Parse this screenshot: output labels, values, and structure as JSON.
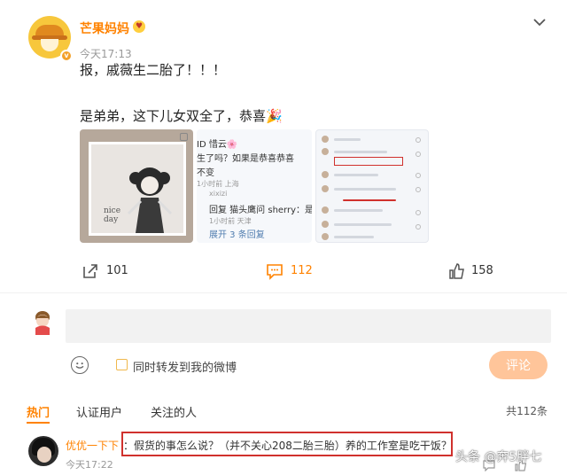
{
  "post": {
    "username": "芒果妈妈",
    "timestamp": "今天17:13",
    "text_line1": "报，戚薇生二胎了！！！",
    "text_line2": "是弟弟，这下儿女双全了，恭喜🎉"
  },
  "media": {
    "image1_note_line1": "nice",
    "image1_note_line2": "day",
    "image2_lines": [
      "ID 惜云🌸",
      "生了吗？如果是恭喜恭喜",
      "不变",
      "1小时前 上海",
      "xixizi",
      "回复 猫头鹰问 sherry：是弟",
      "1小时前 天津",
      "展开 3 条回复"
    ]
  },
  "stats": {
    "repost_count": "101",
    "comment_count": "112",
    "like_count": "158"
  },
  "composer": {
    "forward_label": "同时转发到我的微博",
    "comment_button": "评论"
  },
  "tabs": {
    "items": [
      "热门",
      "认证用户",
      "关注的人"
    ],
    "total": "共112条"
  },
  "comment": {
    "user": "优优一下下",
    "text": "：假货的事怎么说？（并不关心208二胎三胎）养的工作室是吃干饭？",
    "time": "今天17:22"
  },
  "watermark": "头条 @奔5胖七",
  "colors": {
    "accent": "#ff8200",
    "highlight_box": "#d0312d",
    "button_disabled": "#ffc59a"
  }
}
